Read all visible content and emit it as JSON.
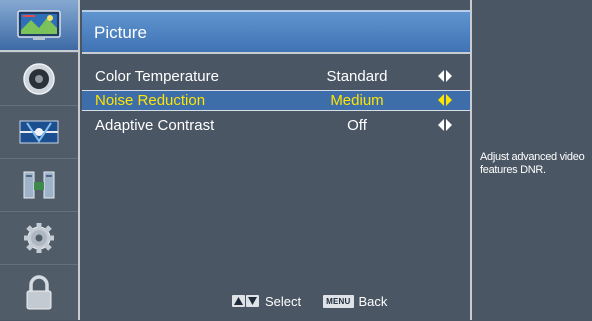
{
  "sidebar": {
    "items": [
      {
        "icon": "picture-icon",
        "active": true
      },
      {
        "icon": "sound-icon",
        "active": false
      },
      {
        "icon": "channel-icon",
        "active": false
      },
      {
        "icon": "setup-icon",
        "active": false
      },
      {
        "icon": "settings-icon",
        "active": false
      },
      {
        "icon": "lock-icon",
        "active": false
      }
    ]
  },
  "header": {
    "title": "Picture"
  },
  "menu": {
    "rows": [
      {
        "label": "Color Temperature",
        "value": "Standard",
        "selected": false
      },
      {
        "label": "Noise Reduction",
        "value": "Medium",
        "selected": true
      },
      {
        "label": "Adaptive Contrast",
        "value": "Off",
        "selected": false
      }
    ]
  },
  "help": {
    "text": "Adjust advanced video features DNR."
  },
  "footer": {
    "select_label": "Select",
    "menu_key": "MENU",
    "back_label": "Back"
  },
  "colors": {
    "background": "#4a5663",
    "header": "#4a80c0",
    "selected_row": "#3d6ea9",
    "selected_text": "#ffe400"
  }
}
